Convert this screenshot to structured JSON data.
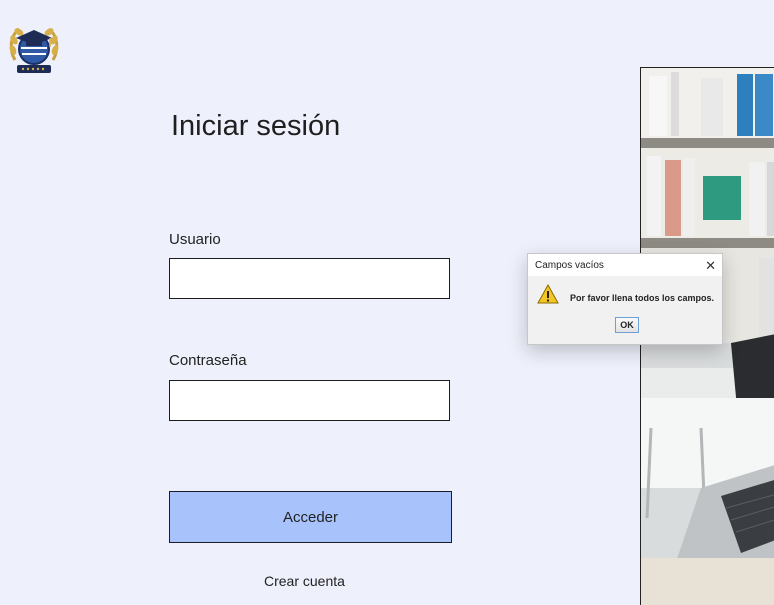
{
  "login": {
    "title": "Iniciar sesión",
    "username_label": "Usuario",
    "username_value": "",
    "password_label": "Contraseña",
    "password_value": "",
    "submit_label": "Acceder",
    "create_account_label": "Crear cuenta"
  },
  "dialog": {
    "title": "Campos vacíos",
    "message": "Por favor llena todos los campos.",
    "ok_label": "OK"
  },
  "icons": {
    "logo": "graduation-cap-laurel-logo",
    "warning": "warning-triangle-icon",
    "close": "close-icon"
  },
  "colors": {
    "background": "#eef0fb",
    "button": "#a8c3fb",
    "border": "#1c1c1c"
  }
}
